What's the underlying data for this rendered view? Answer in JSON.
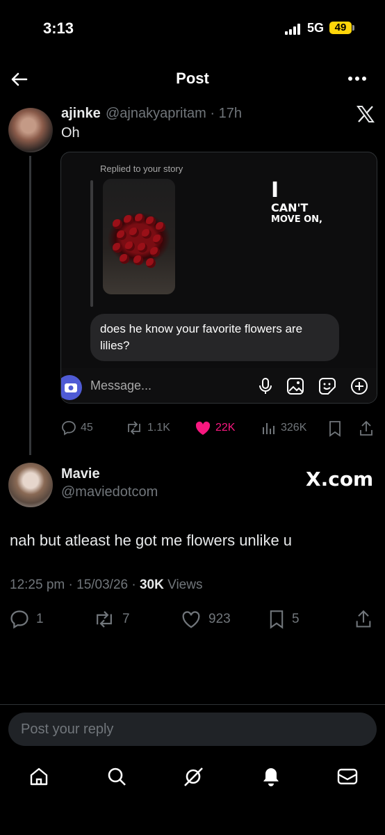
{
  "status_bar": {
    "time": "3:13",
    "network": "5G",
    "battery": "49"
  },
  "header": {
    "title": "Post"
  },
  "tweet1": {
    "name": "ajinke",
    "handle": "@ajnakyapritam · 17h",
    "text": "Oh",
    "image": {
      "replied_label": "Replied to your story",
      "story_caption": [
        "I",
        "CAN'T",
        "MOVE ON,"
      ],
      "reply_message": "does he know your favorite flowers are lilies?",
      "message_placeholder": "Message..."
    },
    "actions": {
      "replies": "45",
      "reposts": "1.1K",
      "likes": "22K",
      "views": "326K"
    },
    "like_color": "#f91880"
  },
  "tweet2": {
    "name": "Mavie",
    "handle": "@maviedotcom",
    "brand": "X.com",
    "text": "nah but atleast he got me flowers unlike u",
    "time": "12:25 pm",
    "date": "15/03/26",
    "views_count": "30K",
    "views_label": "Views",
    "actions": {
      "replies": "1",
      "reposts": "7",
      "likes": "923",
      "bookmarks": "5"
    }
  },
  "reply": {
    "placeholder": "Post your reply"
  },
  "nav_icons": [
    "home-icon",
    "search-icon",
    "grok-icon",
    "notifications-icon",
    "messages-icon"
  ]
}
